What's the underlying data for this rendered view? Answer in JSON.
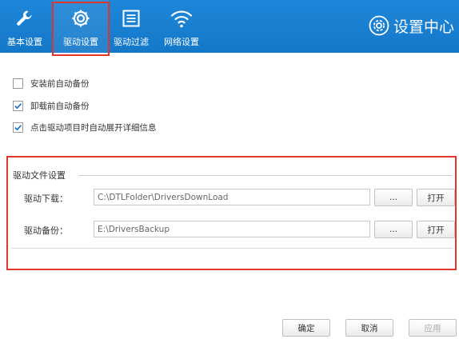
{
  "toolbar": {
    "tabs": [
      {
        "label": "基本设置",
        "icon": "wrench-icon"
      },
      {
        "label": "驱动设置",
        "icon": "gear-icon",
        "active": true
      },
      {
        "label": "驱动过滤",
        "icon": "list-icon"
      },
      {
        "label": "网络设置",
        "icon": "wifi-icon"
      }
    ],
    "title": "设置中心",
    "colors": {
      "bar": "#1a82d4",
      "highlight": "#e0352b"
    }
  },
  "options": [
    {
      "label": "安装前自动备份",
      "checked": false
    },
    {
      "label": "卸载前自动备份",
      "checked": true
    },
    {
      "label": "点击驱动项目时自动展开详细信息",
      "checked": true
    }
  ],
  "driver_files": {
    "title": "驱动文件设置",
    "download": {
      "label": "驱动下载：",
      "value": "C:\\DTLFolder\\DriversDownLoad",
      "browse": "...",
      "open": "打开"
    },
    "backup": {
      "label": "驱动备份：",
      "value": "E:\\DriversBackup",
      "browse": "...",
      "open": "打开"
    }
  },
  "footer": {
    "ok": "确定",
    "cancel": "取消",
    "apply": "应用"
  }
}
